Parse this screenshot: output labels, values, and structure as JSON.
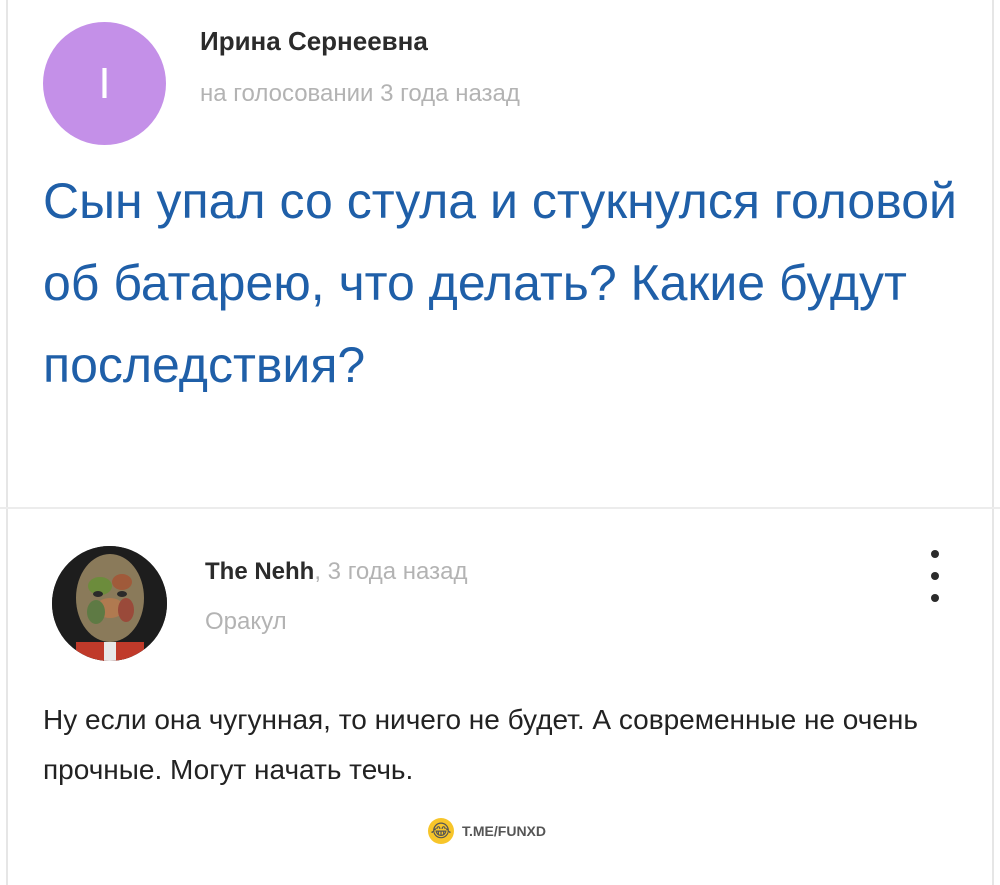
{
  "question": {
    "avatar_letter": "I",
    "author": "Ирина Сернеевна",
    "meta": "на голосовании 3 года назад",
    "title": "Сын упал со стула и стукнулся головой об батарею, что делать? Какие будут последствия?"
  },
  "answer": {
    "author": "The Nehh",
    "time": ", 3 года назад",
    "role": "Оракул",
    "text": "Ну если она чугунная, то ничего не будет. А современные не очень прочные. Могут начать течь.",
    "menu_icon": "more-vertical-icon"
  },
  "watermark": {
    "icon": "laughing-emoji-icon",
    "text": "T.ME/FUNXD"
  },
  "colors": {
    "avatar": "#c490e8",
    "title": "#1f5fa8",
    "muted": "#b3b3b3"
  }
}
